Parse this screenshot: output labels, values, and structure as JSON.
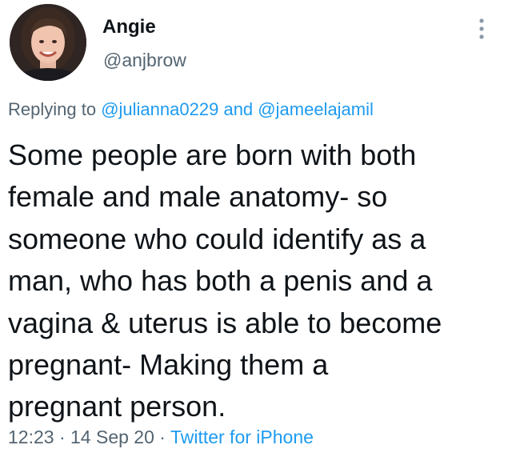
{
  "author": {
    "display_name": "Angie",
    "handle": "@anjbrow"
  },
  "reply": {
    "prefix": "Replying to",
    "mention_1": "@julianna0229",
    "conjunction": "and",
    "mention_2": "@jameelajamil"
  },
  "tweet": {
    "lines": [
      "Some people are born with both",
      "female and male anatomy- so",
      "someone who could identify as a",
      "man, who has both a penis and a",
      "vagina & uterus is able to become",
      "pregnant- Making them a",
      "pregnant person."
    ]
  },
  "meta": {
    "time": "12:23",
    "separator_1": "·",
    "date": "14 Sep 20",
    "separator_2": "·",
    "source": "Twitter for iPhone"
  },
  "icons": {
    "more": "more-vertical-icon"
  },
  "colors": {
    "text_primary": "#0f1419",
    "text_secondary": "#536471",
    "link": "#1d9bf0",
    "background": "#ffffff"
  }
}
